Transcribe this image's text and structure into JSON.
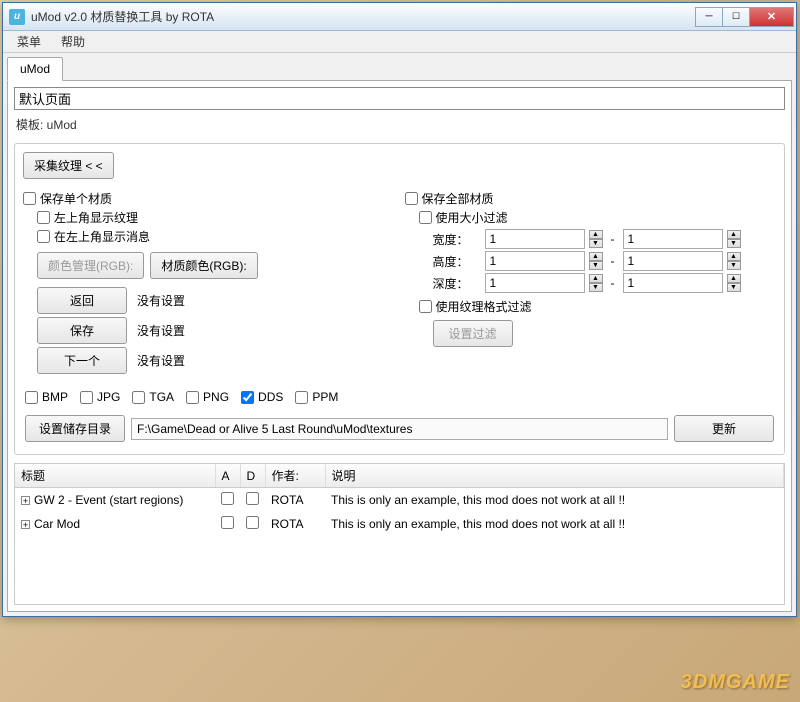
{
  "title": "uMod v2.0 材质替换工具 by ROTA",
  "menu": {
    "main": "菜单",
    "help": "帮助"
  },
  "tab": "uMod",
  "defaultPage": "默认页面",
  "templateLabel": "模板: uMod",
  "collectBtn": "采集纹理 < <",
  "left": {
    "saveSingle": "保存单个材质",
    "showTexTL": "左上角显示纹理",
    "showMsgTL": "在左上角显示消息",
    "colorMgr": "颜色管理(RGB):",
    "texColor": "材质颜色(RGB):",
    "back": "返回",
    "save": "保存",
    "next": "下一个",
    "noSetting": "没有设置"
  },
  "right": {
    "saveAll": "保存全部材质",
    "sizeFilter": "使用大小过滤",
    "width": "宽度：",
    "height": "高度：",
    "depth": "深度：",
    "val": "1",
    "fmtFilter": "使用纹理格式过滤",
    "setFilter": "设置过滤"
  },
  "formats": {
    "bmp": "BMP",
    "jpg": "JPG",
    "tga": "TGA",
    "png": "PNG",
    "dds": "DDS",
    "ppm": "PPM"
  },
  "path": {
    "setDir": "设置储存目录",
    "value": "F:\\Game\\Dead or Alive 5 Last Round\\uMod\\textures",
    "update": "更新"
  },
  "table": {
    "hTitle": "标题",
    "hA": "A",
    "hD": "D",
    "hAuthor": "作者:",
    "hDesc": "说明",
    "rows": [
      {
        "title": "GW 2 - Event  (start regions)",
        "author": "ROTA",
        "desc": "This is only an example, this mod does not work at all !!"
      },
      {
        "title": "Car Mod",
        "author": "ROTA",
        "desc": "This is only an example, this mod does not work at all !!"
      }
    ]
  },
  "watermark": "3DMGAME"
}
